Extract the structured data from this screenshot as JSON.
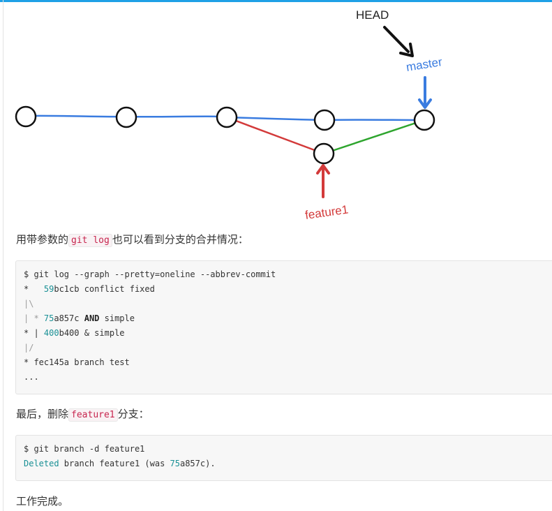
{
  "diagram": {
    "head_label": "HEAD",
    "master_label": "master",
    "feature_label": "feature1",
    "colors": {
      "master_line": "#3a7ce0",
      "feature_line": "#d33a3a",
      "merge_line": "#2ea52e",
      "arrow_head": "#111111"
    }
  },
  "para1": {
    "before": "用带参数的",
    "code": "git log",
    "after": "也可以看到分支的合并情况："
  },
  "block1": {
    "line1": "$ git log --graph --pretty=oneline --abbrev-commit",
    "line2_prefix": "*   ",
    "line2_hash_num": "59",
    "line2_rest": "bc1cb conflict fixed",
    "line3": "|\\",
    "line4_prefix": "| * ",
    "line4_hash_num": "75",
    "line4_hash_rest": "a857c ",
    "line4_kw": "AND",
    "line4_rest": " simple",
    "line5_prefix": "* | ",
    "line5_hash_num": "400",
    "line5_rest": "b400 & simple",
    "line6": "|/",
    "line7": "* fec145a branch test",
    "line8": "..."
  },
  "para2": {
    "before": "最后，删除",
    "code": "feature1",
    "after": "分支："
  },
  "block2": {
    "line1": "$ git branch -d feature1",
    "line2_deleted": "Deleted",
    "line2_mid": " branch feature1 (was ",
    "line2_num": "75",
    "line2_rest": "a857c)."
  },
  "para3": {
    "text": "工作完成。"
  }
}
